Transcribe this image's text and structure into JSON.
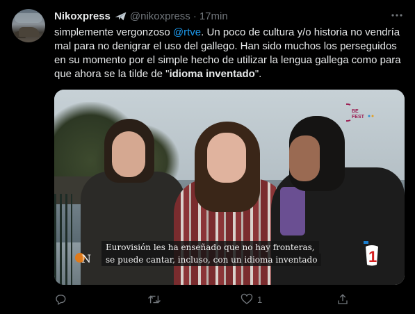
{
  "tweet": {
    "author_name": "Nikoxpress",
    "author_handle": "@nikoxpress",
    "separator": "·",
    "time": "17min",
    "text_part1": "simplemente vergonzoso ",
    "mention": "@rtve",
    "text_part2": ". Un poco de cultura y/o historia no vendría mal para no denigrar el uso del gallego. Han sido muchos los perseguidos en su momento por el simple hecho de utilizar la lengua gallega como para que ahora se la tilde de \"",
    "text_bold": "idioma inventado",
    "text_part3": "\"."
  },
  "media": {
    "caption_line1": "Eurovisión les ha enseñado que no hay fronteras,",
    "caption_line2": "se puede cantar, incluso, con un idioma inventado",
    "corner_logo_letter": "N",
    "benidorm_logo_l1": "BE",
    "benidorm_logo_l2": "FEST",
    "channel_number": "1"
  },
  "actions": {
    "reply_count": "",
    "retweet_count": "",
    "like_count": "1"
  },
  "colors": {
    "background": "#000000",
    "text": "#e7e9ea",
    "muted": "#71767b",
    "link": "#1d9bf0"
  }
}
